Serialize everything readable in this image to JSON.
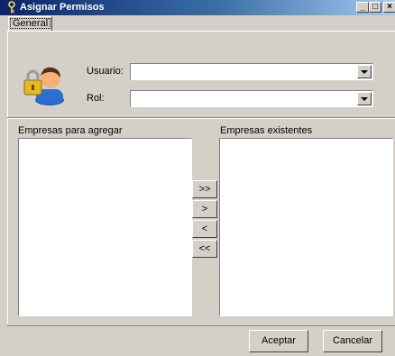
{
  "window": {
    "title": "Asignar Permisos",
    "minimize": "_",
    "maximize": "□",
    "close": "×"
  },
  "tabs": [
    {
      "label": "General"
    }
  ],
  "form": {
    "usuario_label": "Usuario:",
    "usuario_value": "",
    "rol_label": "Rol:",
    "rol_value": ""
  },
  "lists": {
    "left_label": "Empresas para agregar",
    "right_label": "Empresas existentes",
    "left_items": [],
    "right_items": []
  },
  "transfer_buttons": {
    "add_all": ">>",
    "add_one": ">",
    "remove_one": "<",
    "remove_all": "<<"
  },
  "actions": {
    "accept": "Aceptar",
    "cancel": "Cancelar"
  },
  "colors": {
    "face": "#d4d0c8",
    "title_start": "#0a246a",
    "title_end": "#a6caf0"
  },
  "icons": {
    "title": "key-icon",
    "user": "user-lock-icon"
  }
}
